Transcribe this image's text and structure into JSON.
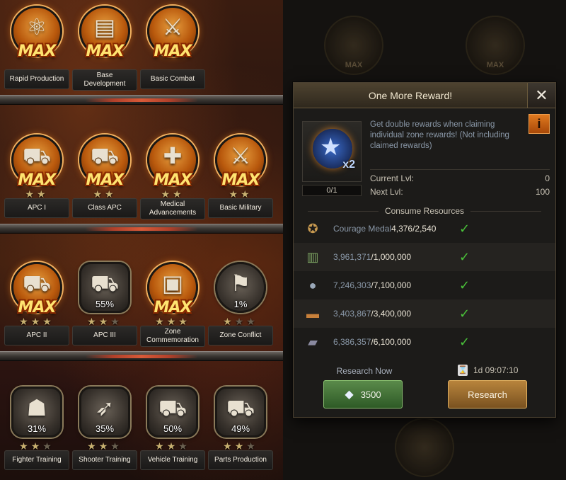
{
  "tree": {
    "rows": [
      {
        "nodes": [
          {
            "label": "Rapid Production",
            "icon": "atom-icon",
            "glyph": "⚛",
            "max": "MAX",
            "percent": "",
            "stars_total": 0,
            "stars_lit": 0,
            "shape": "circle"
          },
          {
            "label": "Base Development",
            "icon": "stack-icon",
            "glyph": "▤",
            "max": "MAX",
            "percent": "",
            "stars_total": 0,
            "stars_lit": 0,
            "shape": "circle"
          },
          {
            "label": "Basic Combat",
            "icon": "crossed-swords-icon",
            "glyph": "⚔",
            "max": "MAX",
            "percent": "",
            "stars_total": 0,
            "stars_lit": 0,
            "shape": "circle"
          }
        ]
      },
      {
        "nodes": [
          {
            "label": "APC I",
            "icon": "truck-icon",
            "glyph": "⛟",
            "max": "MAX",
            "percent": "",
            "stars_total": 2,
            "stars_lit": 2,
            "shape": "circle"
          },
          {
            "label": "Class APC",
            "icon": "truck-icon",
            "glyph": "⛟",
            "max": "MAX",
            "percent": "",
            "stars_total": 2,
            "stars_lit": 2,
            "shape": "circle"
          },
          {
            "label": "Medical Advancements",
            "icon": "medkit-icon",
            "glyph": "✚",
            "max": "MAX",
            "percent": "",
            "stars_total": 2,
            "stars_lit": 2,
            "shape": "circle"
          },
          {
            "label": "Basic Military",
            "icon": "crossed-swords-icon",
            "glyph": "⚔",
            "max": "MAX",
            "percent": "",
            "stars_total": 2,
            "stars_lit": 2,
            "shape": "circle"
          }
        ]
      },
      {
        "nodes": [
          {
            "label": "APC II",
            "icon": "truck-icon",
            "glyph": "⛟",
            "max": "MAX",
            "percent": "",
            "stars_total": 3,
            "stars_lit": 3,
            "shape": "circle"
          },
          {
            "label": "APC III",
            "icon": "truck-icon",
            "glyph": "⛟",
            "max": "",
            "percent": "55%",
            "stars_total": 3,
            "stars_lit": 2,
            "shape": "hex"
          },
          {
            "label": "Zone Commemoration",
            "icon": "crate-icon",
            "glyph": "▣",
            "max": "MAX",
            "percent": "",
            "stars_total": 3,
            "stars_lit": 3,
            "shape": "circle"
          },
          {
            "label": "Zone Conflict",
            "icon": "flag-icon",
            "glyph": "⚑",
            "max": "",
            "percent": "1%",
            "stars_total": 3,
            "stars_lit": 1,
            "shape": "circle"
          }
        ]
      },
      {
        "nodes": [
          {
            "label": "Fighter Training",
            "icon": "helmet-icon",
            "glyph": "☗",
            "max": "",
            "percent": "31%",
            "stars_total": 3,
            "stars_lit": 2,
            "shape": "hex"
          },
          {
            "label": "Shooter Training",
            "icon": "rifleman-icon",
            "glyph": "➶",
            "max": "",
            "percent": "35%",
            "stars_total": 3,
            "stars_lit": 2,
            "shape": "hex"
          },
          {
            "label": "Vehicle Training",
            "icon": "vehicle-icon",
            "glyph": "⛟",
            "max": "",
            "percent": "50%",
            "stars_total": 3,
            "stars_lit": 2,
            "shape": "hex"
          },
          {
            "label": "Parts Production",
            "icon": "crane-truck-icon",
            "glyph": "⛟",
            "max": "",
            "percent": "49%",
            "stars_total": 3,
            "stars_lit": 2,
            "shape": "hex"
          }
        ]
      }
    ]
  },
  "background_badges": [
    {
      "icon": "medal-icon",
      "text": "MAX"
    },
    {
      "icon": "medal-icon",
      "text": "MAX"
    }
  ],
  "dialog": {
    "title": "One More Reward!",
    "close_glyph": "✕",
    "description": "Get double rewards when claiming individual zone rewards! (Not including claimed rewards)",
    "info_glyph": "i",
    "reward_multiplier": "x2",
    "progress": "0/1",
    "current_lvl_label": "Current Lvl:",
    "current_lvl_value": "0",
    "next_lvl_label": "Next Lvl:",
    "next_lvl_value": "100",
    "consume_title": "Consume Resources",
    "resources": [
      {
        "name": "Courage Medal",
        "icon": "medal-icon",
        "glyph": "✪",
        "color": "#c89a50",
        "owned": "4,376",
        "required": "/2,540",
        "check": "✓"
      },
      {
        "name": "",
        "icon": "cash-icon",
        "glyph": "▥",
        "color": "#7aa060",
        "owned": "3,961,371",
        "required": "/1,000,000",
        "check": "✓"
      },
      {
        "name": "",
        "icon": "oil-drop-icon",
        "glyph": "●",
        "color": "#9aa8b8",
        "owned": "7,246,303",
        "required": "/7,100,000",
        "check": "✓"
      },
      {
        "name": "",
        "icon": "wood-icon",
        "glyph": "▬",
        "color": "#c8803a",
        "owned": "3,403,867",
        "required": "/3,400,000",
        "check": "✓"
      },
      {
        "name": "",
        "icon": "steel-icon",
        "glyph": "▰",
        "color": "#8a8aa0",
        "owned": "6,386,357",
        "required": "/6,100,000",
        "check": "✓"
      }
    ],
    "research_now_label": "Research Now",
    "research_now_cost": "3500",
    "gem_glyph": "◆",
    "timer": "1d 09:07:10",
    "hourglass_glyph": "⌛",
    "research_label": "Research"
  },
  "colors": {
    "max_text": "#ffe470",
    "check": "#4ac23a",
    "research_now": "#2e5a26",
    "research": "#7a5220"
  }
}
